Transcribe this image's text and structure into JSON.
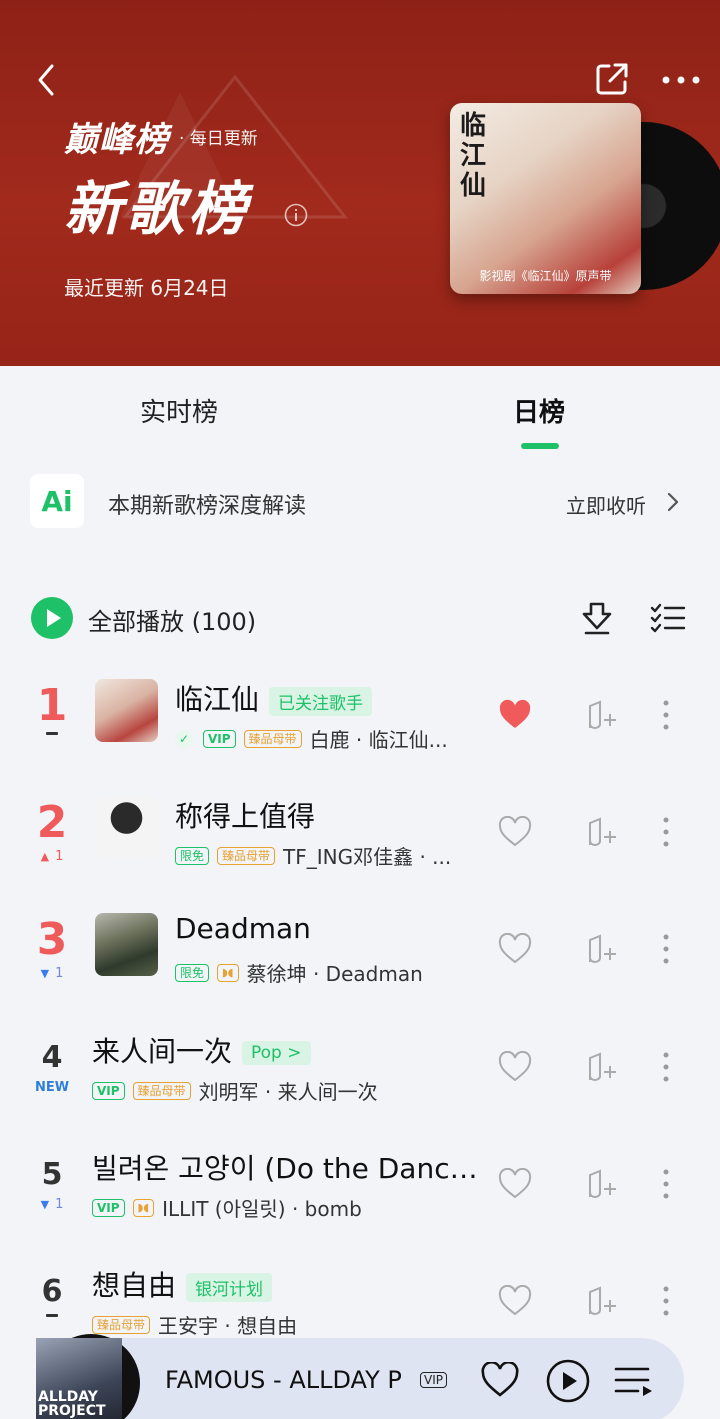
{
  "header": {
    "brand": "巅峰榜",
    "update_freq": "· 每日更新",
    "title": "新歌榜",
    "updated": "最近更新 6月24日",
    "cover_title": "临江仙",
    "cover_caption": "影视剧《临江仙》原声带"
  },
  "tabs": {
    "realtime": "实时榜",
    "daily": "日榜"
  },
  "ai": {
    "logo": "Ai",
    "text": "本期新歌榜深度解读",
    "action": "立即收听"
  },
  "play_all": {
    "label": "全部播放 (100)"
  },
  "songs": [
    {
      "rank": "1",
      "change": "",
      "title": "临江仙",
      "tag": "已关注歌手",
      "badges": [
        "VIP",
        "臻品母带"
      ],
      "meta": "白鹿 · 临江仙...",
      "liked": true
    },
    {
      "rank": "2",
      "change": "1",
      "title": "称得上值得",
      "tag": "",
      "badges": [
        "限免",
        "臻品母带"
      ],
      "meta": "TF_ING邓佳鑫 · ...",
      "liked": false
    },
    {
      "rank": "3",
      "change": "1",
      "title": "Deadman",
      "tag": "",
      "badges": [
        "限免",
        "Dolby"
      ],
      "meta": "蔡徐坤 · Deadman",
      "liked": false
    },
    {
      "rank": "4",
      "change": "NEW",
      "title": "来人间一次",
      "tag": "Pop >",
      "badges": [
        "VIP",
        "臻品母带"
      ],
      "meta": "刘明军 · 来人间一次",
      "liked": false
    },
    {
      "rank": "5",
      "change": "1",
      "title": "빌려온 고양이 (Do the Dance...",
      "tag": "",
      "badges": [
        "VIP",
        "Dolby"
      ],
      "meta": "ILLIT (아일릿) · bomb",
      "liked": false
    },
    {
      "rank": "6",
      "change": "",
      "title": "想自由",
      "tag": "银河计划",
      "badges": [
        "臻品母带"
      ],
      "meta": "王安宇 · 想自由",
      "liked": false
    }
  ],
  "player": {
    "title": "FAMOUS - ALLDAY P",
    "vip": "VIP",
    "cover_text": "ALLDAY PROJECT"
  },
  "colors": {
    "header_bg": "#9b2719",
    "accent": "#1ec168",
    "rank_red": "#ef5a5a",
    "like_red": "#f05a5a"
  }
}
